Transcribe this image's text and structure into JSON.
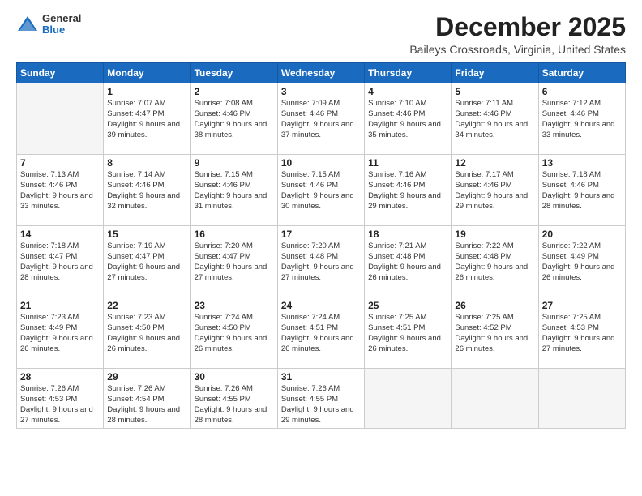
{
  "logo": {
    "general": "General",
    "blue": "Blue"
  },
  "header": {
    "month": "December 2025",
    "location": "Baileys Crossroads, Virginia, United States"
  },
  "days_header": [
    "Sunday",
    "Monday",
    "Tuesday",
    "Wednesday",
    "Thursday",
    "Friday",
    "Saturday"
  ],
  "weeks": [
    [
      {
        "day": "",
        "sunrise": "",
        "sunset": "",
        "daylight": ""
      },
      {
        "day": "1",
        "sunrise": "Sunrise: 7:07 AM",
        "sunset": "Sunset: 4:47 PM",
        "daylight": "Daylight: 9 hours and 39 minutes."
      },
      {
        "day": "2",
        "sunrise": "Sunrise: 7:08 AM",
        "sunset": "Sunset: 4:46 PM",
        "daylight": "Daylight: 9 hours and 38 minutes."
      },
      {
        "day": "3",
        "sunrise": "Sunrise: 7:09 AM",
        "sunset": "Sunset: 4:46 PM",
        "daylight": "Daylight: 9 hours and 37 minutes."
      },
      {
        "day": "4",
        "sunrise": "Sunrise: 7:10 AM",
        "sunset": "Sunset: 4:46 PM",
        "daylight": "Daylight: 9 hours and 35 minutes."
      },
      {
        "day": "5",
        "sunrise": "Sunrise: 7:11 AM",
        "sunset": "Sunset: 4:46 PM",
        "daylight": "Daylight: 9 hours and 34 minutes."
      },
      {
        "day": "6",
        "sunrise": "Sunrise: 7:12 AM",
        "sunset": "Sunset: 4:46 PM",
        "daylight": "Daylight: 9 hours and 33 minutes."
      }
    ],
    [
      {
        "day": "7",
        "sunrise": "Sunrise: 7:13 AM",
        "sunset": "Sunset: 4:46 PM",
        "daylight": "Daylight: 9 hours and 33 minutes."
      },
      {
        "day": "8",
        "sunrise": "Sunrise: 7:14 AM",
        "sunset": "Sunset: 4:46 PM",
        "daylight": "Daylight: 9 hours and 32 minutes."
      },
      {
        "day": "9",
        "sunrise": "Sunrise: 7:15 AM",
        "sunset": "Sunset: 4:46 PM",
        "daylight": "Daylight: 9 hours and 31 minutes."
      },
      {
        "day": "10",
        "sunrise": "Sunrise: 7:15 AM",
        "sunset": "Sunset: 4:46 PM",
        "daylight": "Daylight: 9 hours and 30 minutes."
      },
      {
        "day": "11",
        "sunrise": "Sunrise: 7:16 AM",
        "sunset": "Sunset: 4:46 PM",
        "daylight": "Daylight: 9 hours and 29 minutes."
      },
      {
        "day": "12",
        "sunrise": "Sunrise: 7:17 AM",
        "sunset": "Sunset: 4:46 PM",
        "daylight": "Daylight: 9 hours and 29 minutes."
      },
      {
        "day": "13",
        "sunrise": "Sunrise: 7:18 AM",
        "sunset": "Sunset: 4:46 PM",
        "daylight": "Daylight: 9 hours and 28 minutes."
      }
    ],
    [
      {
        "day": "14",
        "sunrise": "Sunrise: 7:18 AM",
        "sunset": "Sunset: 4:47 PM",
        "daylight": "Daylight: 9 hours and 28 minutes."
      },
      {
        "day": "15",
        "sunrise": "Sunrise: 7:19 AM",
        "sunset": "Sunset: 4:47 PM",
        "daylight": "Daylight: 9 hours and 27 minutes."
      },
      {
        "day": "16",
        "sunrise": "Sunrise: 7:20 AM",
        "sunset": "Sunset: 4:47 PM",
        "daylight": "Daylight: 9 hours and 27 minutes."
      },
      {
        "day": "17",
        "sunrise": "Sunrise: 7:20 AM",
        "sunset": "Sunset: 4:48 PM",
        "daylight": "Daylight: 9 hours and 27 minutes."
      },
      {
        "day": "18",
        "sunrise": "Sunrise: 7:21 AM",
        "sunset": "Sunset: 4:48 PM",
        "daylight": "Daylight: 9 hours and 26 minutes."
      },
      {
        "day": "19",
        "sunrise": "Sunrise: 7:22 AM",
        "sunset": "Sunset: 4:48 PM",
        "daylight": "Daylight: 9 hours and 26 minutes."
      },
      {
        "day": "20",
        "sunrise": "Sunrise: 7:22 AM",
        "sunset": "Sunset: 4:49 PM",
        "daylight": "Daylight: 9 hours and 26 minutes."
      }
    ],
    [
      {
        "day": "21",
        "sunrise": "Sunrise: 7:23 AM",
        "sunset": "Sunset: 4:49 PM",
        "daylight": "Daylight: 9 hours and 26 minutes."
      },
      {
        "day": "22",
        "sunrise": "Sunrise: 7:23 AM",
        "sunset": "Sunset: 4:50 PM",
        "daylight": "Daylight: 9 hours and 26 minutes."
      },
      {
        "day": "23",
        "sunrise": "Sunrise: 7:24 AM",
        "sunset": "Sunset: 4:50 PM",
        "daylight": "Daylight: 9 hours and 26 minutes."
      },
      {
        "day": "24",
        "sunrise": "Sunrise: 7:24 AM",
        "sunset": "Sunset: 4:51 PM",
        "daylight": "Daylight: 9 hours and 26 minutes."
      },
      {
        "day": "25",
        "sunrise": "Sunrise: 7:25 AM",
        "sunset": "Sunset: 4:51 PM",
        "daylight": "Daylight: 9 hours and 26 minutes."
      },
      {
        "day": "26",
        "sunrise": "Sunrise: 7:25 AM",
        "sunset": "Sunset: 4:52 PM",
        "daylight": "Daylight: 9 hours and 26 minutes."
      },
      {
        "day": "27",
        "sunrise": "Sunrise: 7:25 AM",
        "sunset": "Sunset: 4:53 PM",
        "daylight": "Daylight: 9 hours and 27 minutes."
      }
    ],
    [
      {
        "day": "28",
        "sunrise": "Sunrise: 7:26 AM",
        "sunset": "Sunset: 4:53 PM",
        "daylight": "Daylight: 9 hours and 27 minutes."
      },
      {
        "day": "29",
        "sunrise": "Sunrise: 7:26 AM",
        "sunset": "Sunset: 4:54 PM",
        "daylight": "Daylight: 9 hours and 28 minutes."
      },
      {
        "day": "30",
        "sunrise": "Sunrise: 7:26 AM",
        "sunset": "Sunset: 4:55 PM",
        "daylight": "Daylight: 9 hours and 28 minutes."
      },
      {
        "day": "31",
        "sunrise": "Sunrise: 7:26 AM",
        "sunset": "Sunset: 4:55 PM",
        "daylight": "Daylight: 9 hours and 29 minutes."
      },
      {
        "day": "",
        "sunrise": "",
        "sunset": "",
        "daylight": ""
      },
      {
        "day": "",
        "sunrise": "",
        "sunset": "",
        "daylight": ""
      },
      {
        "day": "",
        "sunrise": "",
        "sunset": "",
        "daylight": ""
      }
    ]
  ]
}
